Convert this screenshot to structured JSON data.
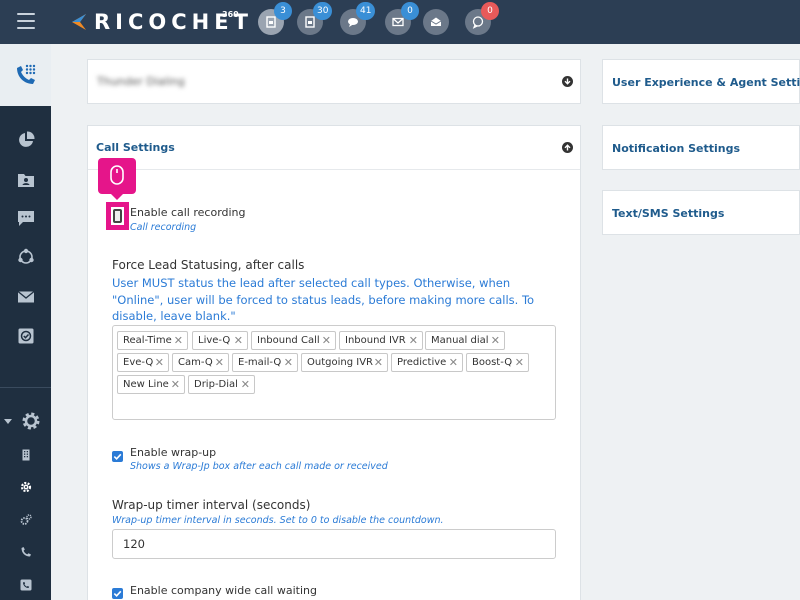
{
  "brand": {
    "name": "RICOCHET",
    "sup": "360"
  },
  "topnav": {
    "items": [
      {
        "name": "leads-icon",
        "badge": "3",
        "badge_color": "#3a8fd6"
      },
      {
        "name": "documents-icon",
        "badge": "30",
        "badge_color": "#3a8fd6"
      },
      {
        "name": "chat-icon",
        "badge": "41",
        "badge_color": "#3a8fd6"
      },
      {
        "name": "email-icon",
        "badge": "0",
        "badge_color": "#3a8fd6"
      },
      {
        "name": "inbox-icon",
        "badge": "",
        "badge_color": ""
      },
      {
        "name": "sms-icon",
        "badge": "0",
        "badge_color": "#e85a5a"
      }
    ]
  },
  "panels": {
    "blurred_title": "Thunder Dialing",
    "call_settings_title": "Call Settings",
    "right": [
      {
        "title": "User Experience & Agent Settings"
      },
      {
        "title": "Notification Settings"
      },
      {
        "title": "Text/SMS Settings"
      }
    ]
  },
  "call_settings": {
    "enable_recording_label": "Enable call recording",
    "enable_recording_hint": "Call recording",
    "force_lead_heading": "Force Lead Statusing, after calls",
    "force_lead_desc": "User MUST status the lead after selected call types. Otherwise, when \"Online\", user will be forced to status leads, before making more calls. To disable, leave blank.\"",
    "tags": [
      "Real-Time",
      "Live-Q",
      "Inbound Call",
      "Inbound IVR",
      "Manual dial",
      "Eve-Q",
      "Cam-Q",
      "E-mail-Q",
      "Outgoing IVR",
      "Predictive",
      "Boost-Q",
      "New Line",
      "Drip-Dial"
    ],
    "wrapup_label": "Enable wrap-up",
    "wrapup_hint": "Shows a Wrap-Jp box after each call made or received",
    "wrapup_timer_heading": "Wrap-up timer interval (seconds)",
    "wrapup_timer_hint": "Wrap-up timer interval in seconds. Set to 0 to disable the countdown.",
    "wrapup_timer_value": "120",
    "company_wait_label": "Enable company wide call waiting"
  },
  "colors": {
    "accent": "#2b7bd6",
    "title": "#1f5b8c",
    "topbar": "#2c3e54",
    "sidebar": "#1f2f40",
    "highlight": "#e5158a"
  }
}
